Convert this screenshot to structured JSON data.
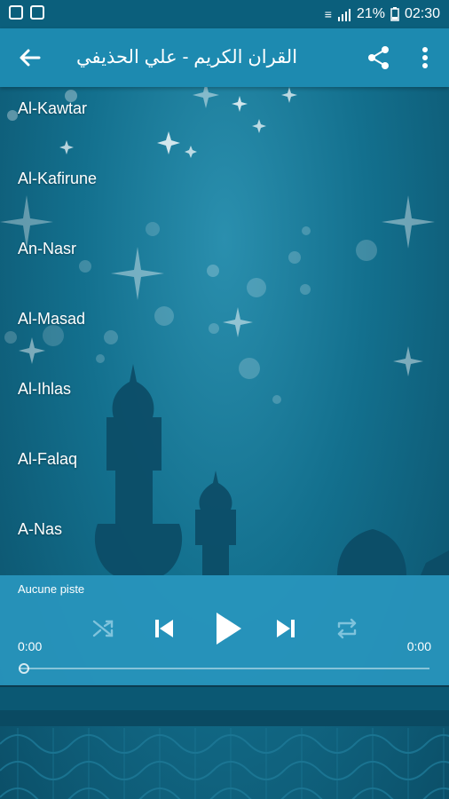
{
  "status_bar": {
    "battery_percent": "21%",
    "time": "02:30",
    "left_icons": [
      "photo-notification-icon",
      "gallery-notification-icon"
    ],
    "right_icons": [
      "vibrate-icon",
      "signal-icon",
      "battery-icon"
    ]
  },
  "app_bar": {
    "title": "القران الكريم - علي الحذيفي",
    "icons": [
      "back-arrow-icon",
      "share-icon",
      "more-vert-icon"
    ]
  },
  "surah_list": [
    {
      "label": "Al-Kawtar"
    },
    {
      "label": "Al-Kafirune"
    },
    {
      "label": "An-Nasr"
    },
    {
      "label": "Al-Masad"
    },
    {
      "label": "Al-Ihlas"
    },
    {
      "label": "Al-Falaq"
    },
    {
      "label": "A-Nas"
    }
  ],
  "player": {
    "track_title": "Aucune piste",
    "time_elapsed": "0:00",
    "time_total": "0:00",
    "progress": 0,
    "icons": [
      "shuffle-icon",
      "skip-previous-icon",
      "play-icon",
      "skip-next-icon",
      "repeat-icon"
    ]
  },
  "colors": {
    "app_bar": "#1d8ab0",
    "status_bar": "#0b5f7c",
    "player_bg": "#2896be",
    "background": "#13708e"
  }
}
